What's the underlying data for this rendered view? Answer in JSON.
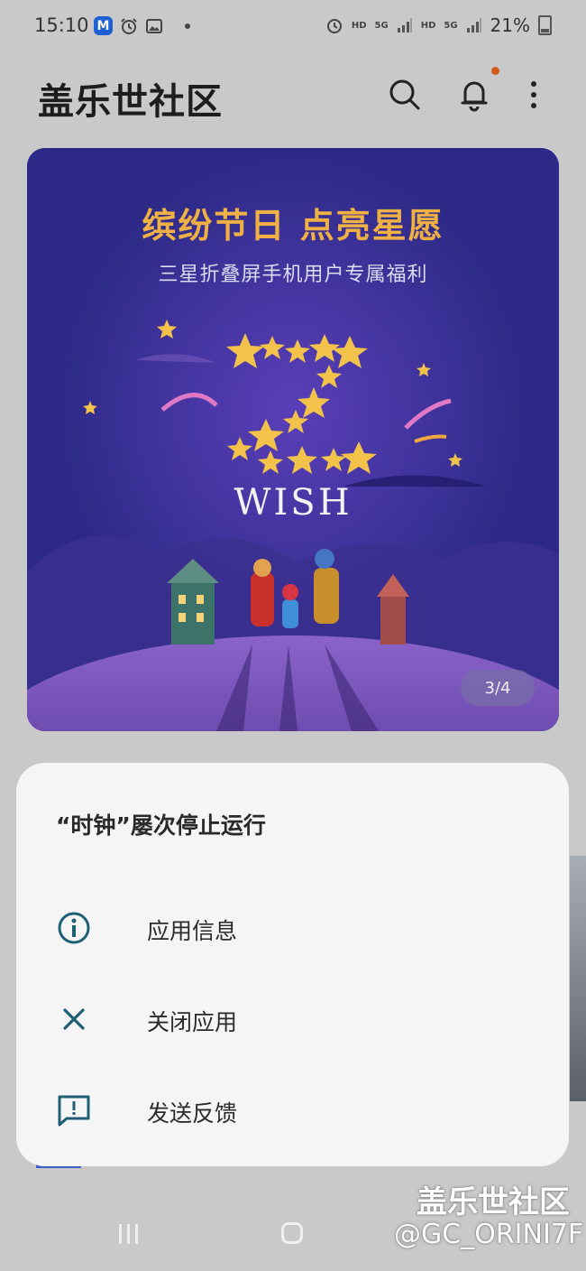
{
  "status_bar": {
    "time": "15:10",
    "app_badge": "M",
    "net1": "HD",
    "gen1": "5G",
    "net2": "HD",
    "gen2": "5G",
    "battery": "21%"
  },
  "header": {
    "title": "盖乐世社区",
    "icons": [
      "search-icon",
      "bell-icon",
      "more-vert-icon"
    ],
    "accent_color": "#d35a1c"
  },
  "banner": {
    "headline": "缤纷节日 点亮星愿",
    "subtitle": "三星折叠屏手机用户专属福利",
    "artwork_text": "WISH",
    "pager": "3/4"
  },
  "dialog": {
    "title": "“时钟”屡次停止运行",
    "items": [
      {
        "label": "应用信息",
        "icon": "info-icon"
      },
      {
        "label": "关闭应用",
        "icon": "close-icon"
      },
      {
        "label": "发送反馈",
        "icon": "feedback-icon"
      }
    ],
    "icon_color": "#1f5f76"
  },
  "watermark": {
    "line1": "盖乐世社区",
    "line2": "@GC_ORINI7F"
  }
}
